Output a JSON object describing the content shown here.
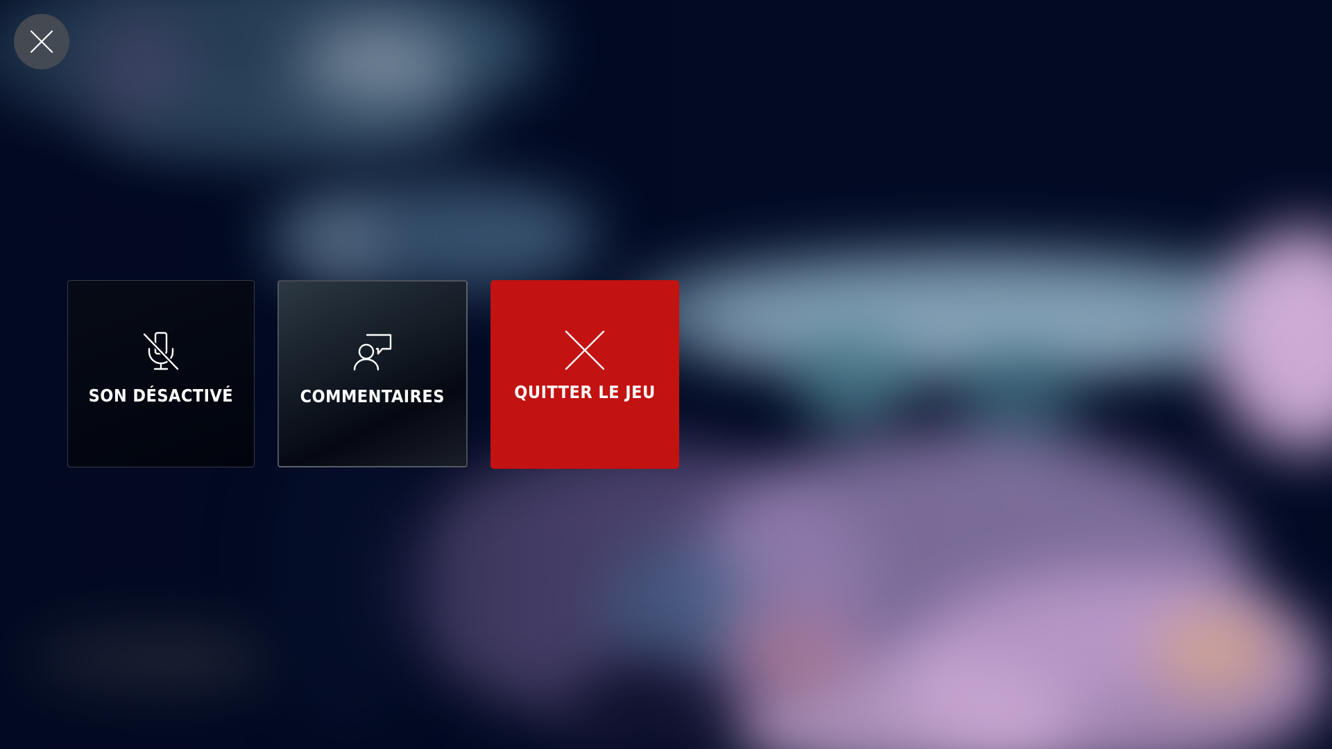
{
  "overlay": {
    "close_icon": "close-icon"
  },
  "menu": {
    "tiles": [
      {
        "label": "SON DÉSACTIVÉ",
        "icon": "microphone-muted-icon",
        "color": "#03060f"
      },
      {
        "label": "COMMENTAIRES",
        "icon": "user-feedback-icon",
        "color": "#1c2530"
      },
      {
        "label": "QUITTER LE JEU",
        "icon": "close-icon",
        "color": "#c21211"
      }
    ]
  },
  "colors": {
    "background": "#020a24",
    "close_button": "#484c54",
    "accent_red": "#c21211",
    "text": "#ffffff"
  }
}
